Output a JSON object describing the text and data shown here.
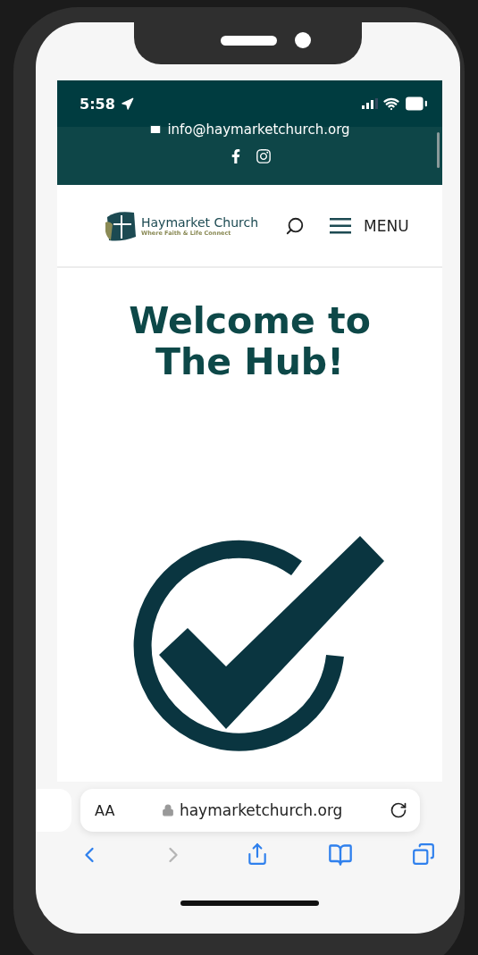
{
  "status_bar": {
    "time": "5:58"
  },
  "top_bar": {
    "email": "info@haymarketchurch.org"
  },
  "header": {
    "logo_name": "Haymarket Church",
    "logo_tagline": "Where Faith & Life Connect",
    "menu_label": "MENU"
  },
  "page": {
    "title": "Welcome to The Hub!"
  },
  "browser": {
    "text_size_label": "AA",
    "url": "haymarketchurch.org",
    "nav_buttons": [
      {
        "kind": "back",
        "disabled": false
      },
      {
        "kind": "forward",
        "disabled": true
      },
      {
        "kind": "share",
        "disabled": false
      },
      {
        "kind": "bookmarks",
        "disabled": false
      },
      {
        "kind": "tabs",
        "disabled": false
      }
    ]
  }
}
